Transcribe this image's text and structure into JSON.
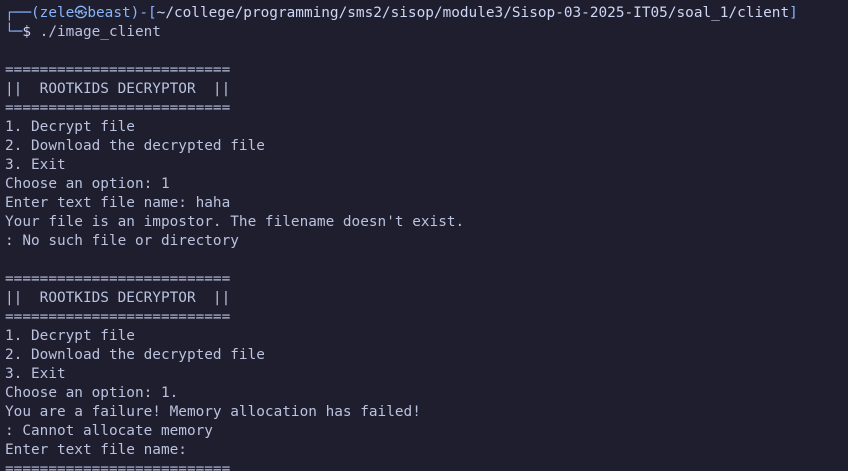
{
  "prompt": {
    "box_top": "┌──(",
    "user": "zele",
    "separator": "㉿",
    "host": "beast",
    "mid": ")-[",
    "path": "~/college/programming/sms2/sisop/module3/Sisop-03-2025-IT05/soal_1/client",
    "close": "]",
    "box_bottom": "└─",
    "dollar": "$",
    "command": " ./image_client"
  },
  "output_lines": [
    "",
    "==========================",
    "||  ROOTKIDS DECRYPTOR  ||",
    "==========================",
    "1. Decrypt file",
    "2. Download the decrypted file",
    "3. Exit",
    "Choose an option: 1",
    "Enter text file name: haha",
    "Your file is an impostor. The filename doesn't exist.",
    ": No such file or directory",
    "",
    "==========================",
    "||  ROOTKIDS DECRYPTOR  ||",
    "==========================",
    "1. Decrypt file",
    "2. Download the decrypted file",
    "3. Exit",
    "Choose an option: 1.",
    "You are a failure! Memory allocation has failed!",
    ": Cannot allocate memory",
    "Enter text file name:",
    "=========================="
  ],
  "colors": {
    "background": "#1e1e2e",
    "prompt_accent": "#89b4fa",
    "text": "#bac2de"
  }
}
